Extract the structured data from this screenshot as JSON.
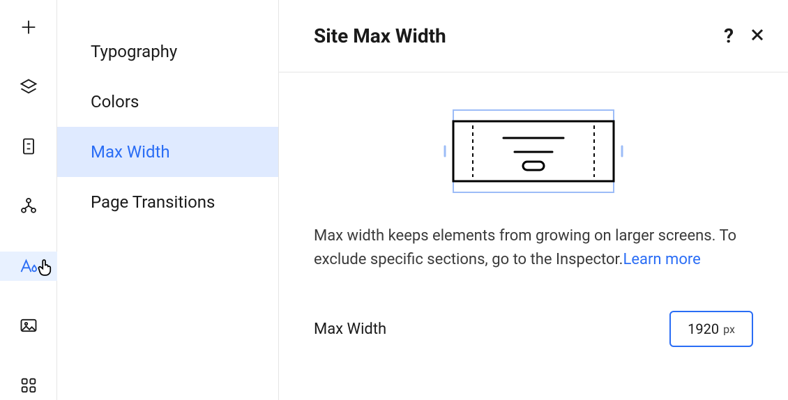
{
  "nav": {
    "items": [
      {
        "label": "Typography",
        "active": false
      },
      {
        "label": "Colors",
        "active": false
      },
      {
        "label": "Max Width",
        "active": true
      },
      {
        "label": "Page Transitions",
        "active": false
      }
    ]
  },
  "panel": {
    "title": "Site Max Width",
    "description_pre": "Max width keeps elements from growing on larger screens. To exclude specific sections, go to the Inspector.",
    "learn_more_label": "Learn more",
    "field_label": "Max Width",
    "field_value": "1920",
    "field_unit": "px"
  },
  "rail": {
    "active_index": 4
  }
}
